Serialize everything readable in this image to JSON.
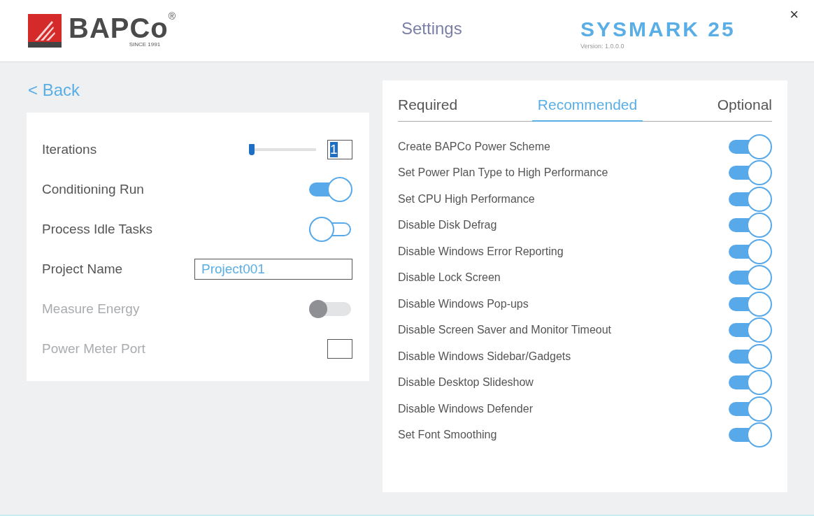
{
  "header": {
    "logo": {
      "name": "BAPCo",
      "mark": "®",
      "tagline": "SINCE 1991"
    },
    "title": "Settings",
    "product": {
      "name": "SYSMARK 25",
      "version": "Version: 1.0.0.0"
    },
    "close": "×"
  },
  "back": "< Back",
  "settings": [
    {
      "kind": "slider",
      "label": "Iterations",
      "disabled": false,
      "level": 0.0,
      "value": "1"
    },
    {
      "kind": "toggle",
      "label": "Conditioning Run",
      "disabled": false,
      "on": true
    },
    {
      "kind": "toggle",
      "label": "Process Idle Tasks",
      "disabled": false,
      "on": false
    },
    {
      "kind": "text",
      "label": "Project Name",
      "disabled": false,
      "value": "Project001"
    },
    {
      "kind": "toggle",
      "label": "Measure Energy",
      "disabled": true,
      "on": false
    },
    {
      "kind": "small",
      "label": "Power Meter Port",
      "disabled": true
    }
  ],
  "tabs": [
    {
      "label": "Required",
      "selected": false
    },
    {
      "label": "Recommended",
      "selected": true
    },
    {
      "label": "Optional",
      "selected": false
    }
  ],
  "options": [
    {
      "label": "Create BAPCo Power Scheme",
      "on": true
    },
    {
      "label": "Set Power Plan Type to High Performance",
      "on": true
    },
    {
      "label": "Set CPU High Performance",
      "on": true
    },
    {
      "label": "Disable Disk Defrag",
      "on": true
    },
    {
      "label": "Disable Windows Error Reporting",
      "on": true
    },
    {
      "label": "Disable Lock Screen",
      "on": true
    },
    {
      "label": "Disable Windows Pop-ups",
      "on": true
    },
    {
      "label": "Disable Screen Saver and Monitor Timeout",
      "on": true
    },
    {
      "label": "Disable Windows Sidebar/Gadgets",
      "on": true
    },
    {
      "label": "Disable Desktop Slideshow",
      "on": true
    },
    {
      "label": "Disable Windows Defender",
      "on": true
    },
    {
      "label": "Set Font Smoothing",
      "on": true
    }
  ]
}
